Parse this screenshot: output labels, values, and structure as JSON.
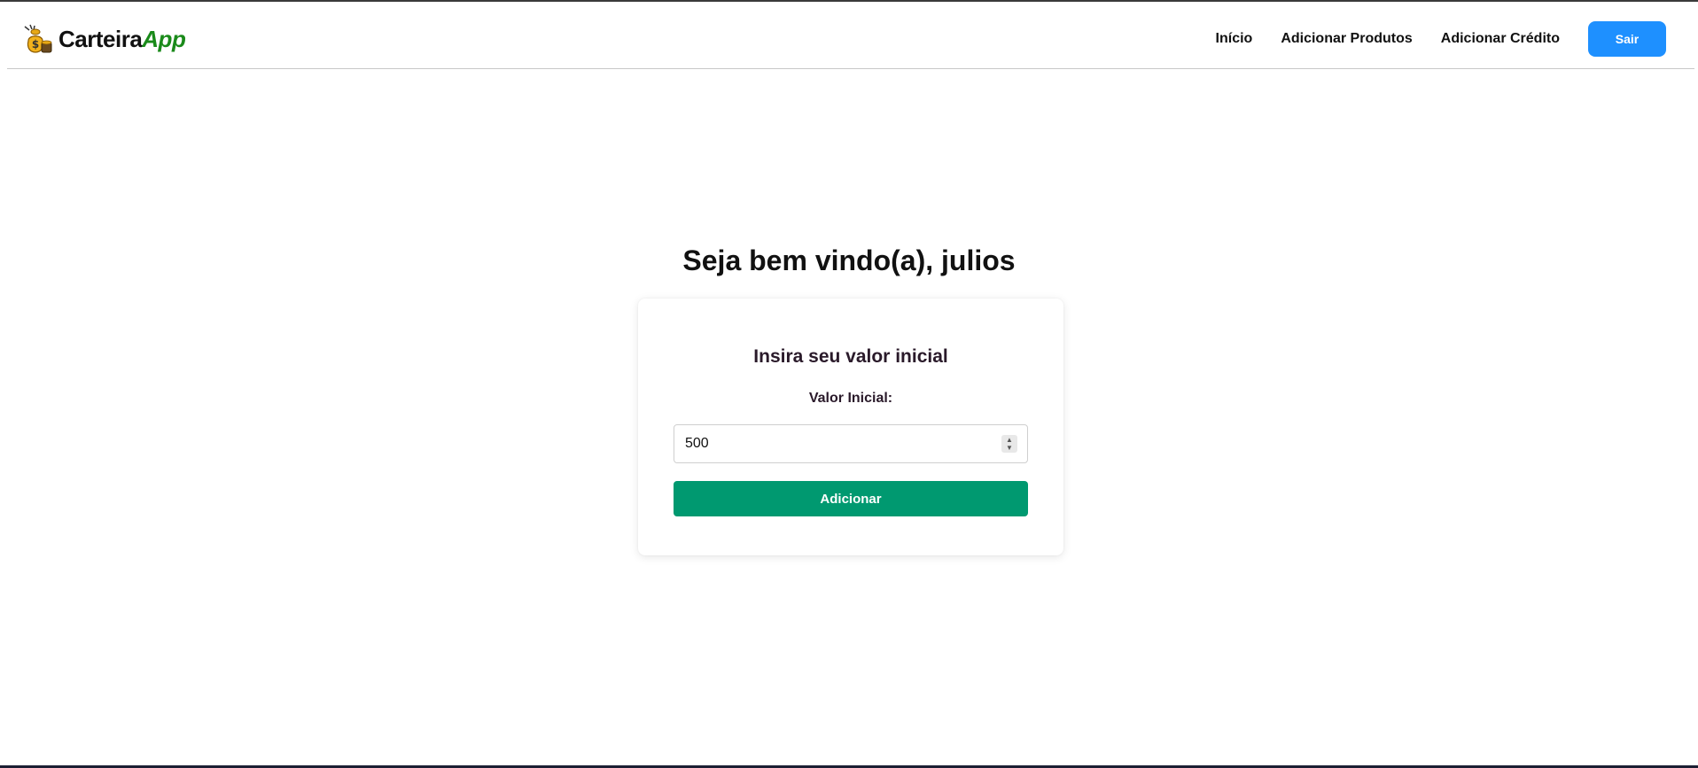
{
  "brand": {
    "name_main": "Carteira",
    "name_accent": "App",
    "logo_icon": "money-bag-icon"
  },
  "nav": {
    "links": [
      "Início",
      "Adicionar Produtos",
      "Adicionar Crédito"
    ],
    "logout_label": "Sair"
  },
  "main": {
    "welcome": "Seja bem vindo(a), julios"
  },
  "card": {
    "title": "Insira seu valor inicial",
    "field_label": "Valor Inicial:",
    "field_value": "500",
    "submit_label": "Adicionar"
  },
  "colors": {
    "accent_green": "#009970",
    "brand_green": "#1a8a1a",
    "logout_blue": "#1e90ff"
  }
}
